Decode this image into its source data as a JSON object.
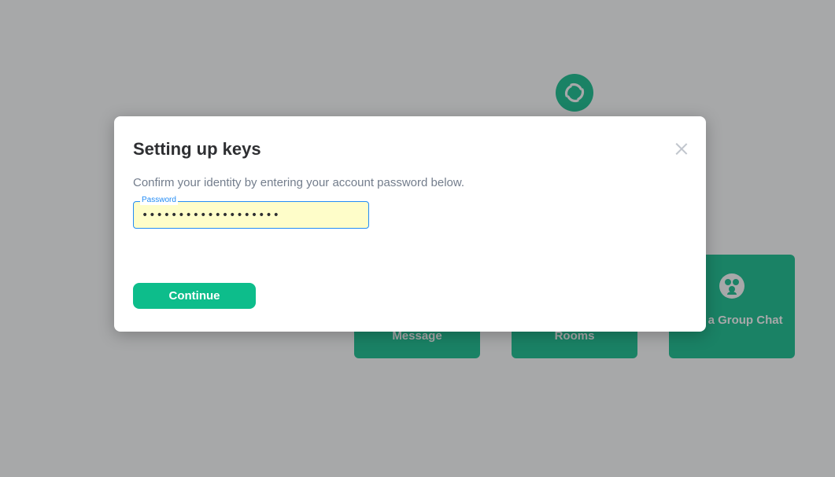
{
  "background": {
    "tiles": [
      {
        "label": "Message"
      },
      {
        "label": "Rooms"
      },
      {
        "label": "eate a Group Chat"
      }
    ]
  },
  "dialog": {
    "title": "Setting up keys",
    "description": "Confirm your identity by entering your account password below.",
    "password_field": {
      "label": "Password",
      "value": "•••••••••••••••••••"
    },
    "continue_label": "Continue"
  },
  "colors": {
    "accent": "#0dbd8b",
    "field_focus": "#238cf5",
    "field_autofill_bg": "#fefdc9"
  },
  "icons": [
    "element-logo-icon",
    "group-people-icon",
    "close-icon"
  ]
}
